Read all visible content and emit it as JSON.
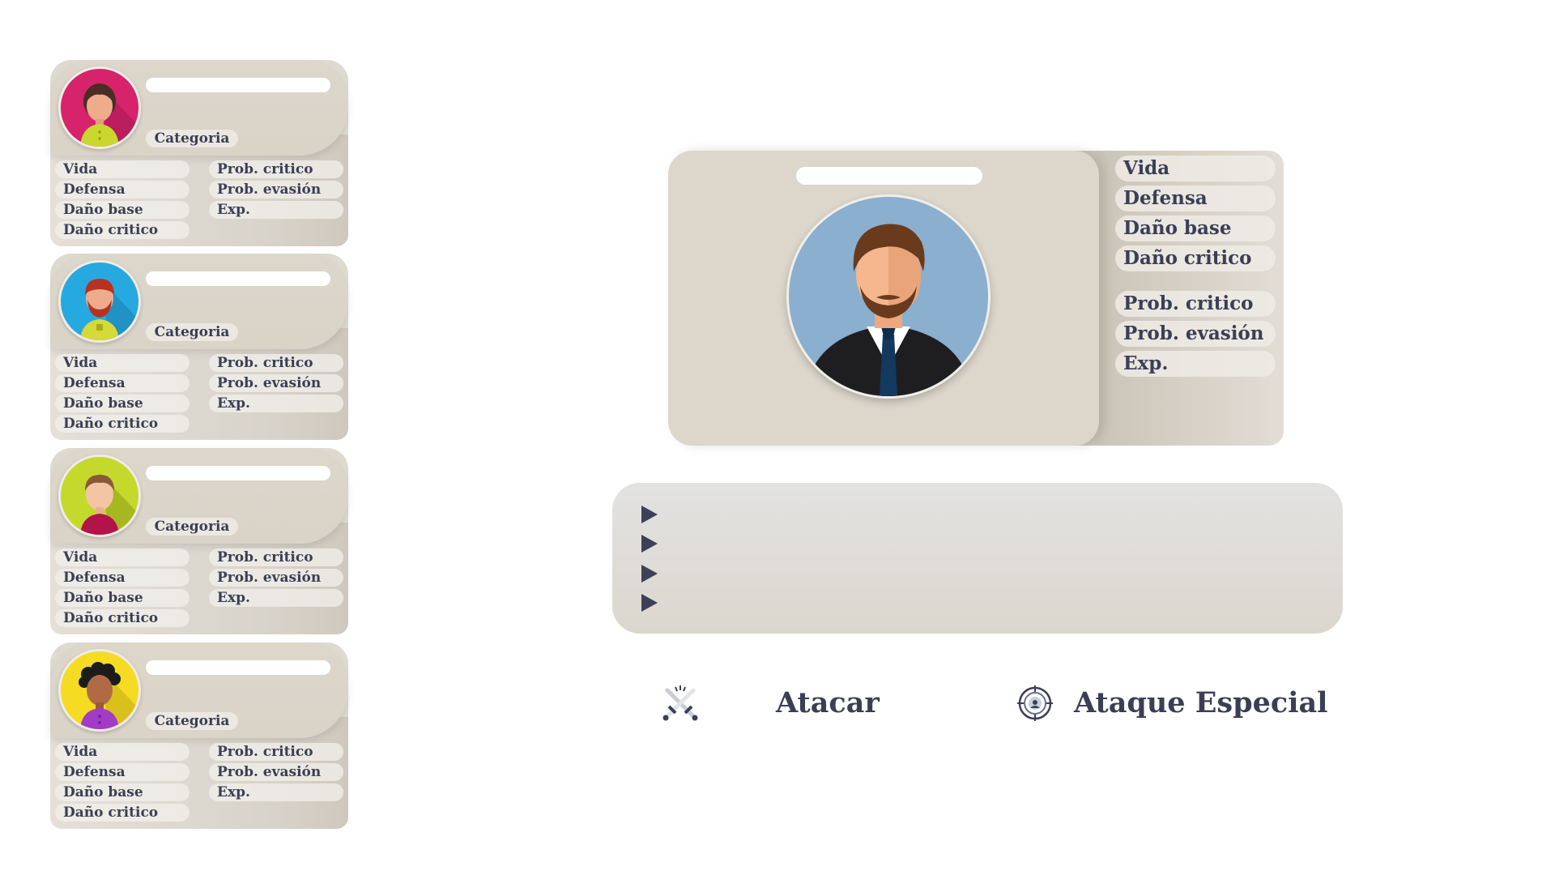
{
  "party": [
    {
      "category_label": "Categoria",
      "stats_left": [
        "Vida",
        "Defensa",
        "Daño base",
        "Daño critico"
      ],
      "stats_right": [
        "Prob. critico",
        "Prob. evasión",
        "Exp."
      ],
      "avatar_icon": "woman-avatar-icon",
      "avatar_bg": "#d6236b"
    },
    {
      "category_label": "Categoria",
      "stats_left": [
        "Vida",
        "Defensa",
        "Daño base",
        "Daño critico"
      ],
      "stats_right": [
        "Prob. critico",
        "Prob. evasión",
        "Exp."
      ],
      "avatar_icon": "bearded-man-avatar-icon",
      "avatar_bg": "#26a9e0"
    },
    {
      "category_label": "Categoria",
      "stats_left": [
        "Vida",
        "Defensa",
        "Daño base",
        "Daño critico"
      ],
      "stats_right": [
        "Prob. critico",
        "Prob. evasión",
        "Exp."
      ],
      "avatar_icon": "boy-avatar-icon",
      "avatar_bg": "#c5d92d"
    },
    {
      "category_label": "Categoria",
      "stats_left": [
        "Vida",
        "Defensa",
        "Daño base",
        "Daño critico"
      ],
      "stats_right": [
        "Prob. critico",
        "Prob. evasión",
        "Exp."
      ],
      "avatar_icon": "curly-hair-avatar-icon",
      "avatar_bg": "#f5dc23"
    }
  ],
  "main_character": {
    "avatar_icon": "businessman-avatar-icon",
    "avatar_bg": "#8aafcf",
    "stats": [
      "Vida",
      "Defensa",
      "Daño base",
      "Daño critico"
    ],
    "stats_extra": [
      "Prob. critico",
      "Prob. evasión",
      "Exp."
    ]
  },
  "log": {
    "lines": [
      "",
      "",
      "",
      ""
    ],
    "bullet_icon": "play-arrow-icon"
  },
  "actions": {
    "attack_label": "Atacar",
    "attack_icon": "crossed-swords-icon",
    "special_label": "Ataque Especial",
    "special_icon": "target-icon"
  },
  "colors": {
    "text": "#3a3f55",
    "card": "#dcd6cb"
  }
}
